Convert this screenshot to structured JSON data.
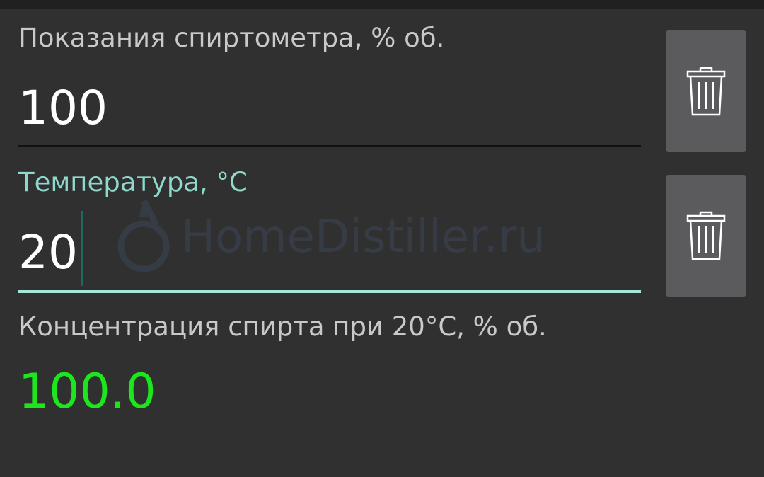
{
  "colors": {
    "background": "#303030",
    "label": "#c9c9c9",
    "focused_label": "#8fd8cc",
    "result_value": "#1ee61e",
    "button": "#5b5b5d"
  },
  "form": {
    "hydrometer": {
      "label": "Показания спиртометра, % об.",
      "value": "100"
    },
    "temperature": {
      "label": "Температура, °C",
      "value": "20"
    },
    "result": {
      "label": "Концентрация спирта при 20°C, % об.",
      "value": "100.0"
    }
  },
  "buttons": {
    "clear_hydrometer_icon": "trash-icon",
    "clear_temperature_icon": "trash-icon"
  },
  "watermark": {
    "text": "HomeDistiller.ru"
  }
}
